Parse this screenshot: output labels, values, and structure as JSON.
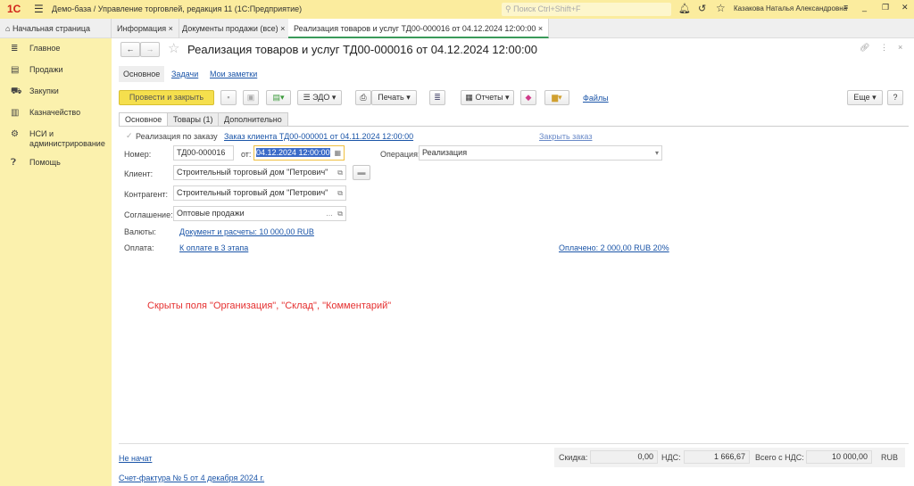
{
  "app": {
    "title": "Демо-база / Управление торговлей, редакция 11  (1С:Предприятие)",
    "search_placeholder": "Поиск Ctrl+Shift+F",
    "user": "Казакова Наталья Александровна"
  },
  "tabs": [
    {
      "label": "Начальная страница"
    },
    {
      "label": "Информация"
    },
    {
      "label": "Документы продажи (все)"
    },
    {
      "label": "Реализация товаров и услуг ТД00-000016 от 04.12.2024 12:00:00"
    }
  ],
  "sidebar": {
    "items": [
      {
        "label": "Главное",
        "icon": "menu-icon"
      },
      {
        "label": "Продажи",
        "icon": "sales-icon"
      },
      {
        "label": "Закупки",
        "icon": "cart-icon"
      },
      {
        "label": "Казначейство",
        "icon": "treasury-icon"
      },
      {
        "label": "НСИ и администрирование",
        "icon": "settings-icon"
      },
      {
        "label": "Помощь",
        "icon": "help-icon"
      }
    ]
  },
  "doc": {
    "title": "Реализация товаров и услуг ТД00-000016 от 04.12.2024 12:00:00",
    "subtabs": [
      "Основное",
      "Задачи",
      "Мои заметки"
    ],
    "toolbar": {
      "post_close": "Провести и закрыть",
      "edo": "ЭДО",
      "print": "Печать",
      "reports": "Отчеты",
      "files": "Файлы",
      "more": "Еще",
      "help": "?"
    },
    "form_tabs": [
      "Основное",
      "Товары (1)",
      "Дополнительно"
    ],
    "by_order_label": "Реализация по заказу",
    "order_link": "Заказ клиента ТД00-000001 от 04.11.2024 12:00:00",
    "close_order": "Закрыть заказ",
    "number_label": "Номер:",
    "number": "ТД00-000016",
    "date_label": "от:",
    "date": "04.12.2024 12:00:00",
    "operation_label": "Операция:",
    "operation": "Реализация",
    "client_label": "Клиент:",
    "client": "Строительный торговый дом \"Петрович\"",
    "contractor_label": "Контрагент:",
    "contractor": "Строительный торговый дом \"Петрович\"",
    "agreement_label": "Соглашение:",
    "agreement": "Оптовые продажи",
    "currency_label": "Валюты:",
    "currency_link": "Документ и расчеты: 10 000,00 RUB",
    "payment_label": "Оплата:",
    "payment_link": "К оплате в 3 этапа",
    "paid_link": "Оплачено: 2 000,00 RUB 20%",
    "note": "Скрыты поля \"Организация\", \"Склад\", \"Комментарий\"",
    "status_link": "Не начат",
    "invoice_link": "Счет-фактура № 5 от 4 декабря 2024 г.",
    "totals": {
      "discount_label": "Скидка:",
      "discount": "0,00",
      "vat_label": "НДС:",
      "vat": "1 666,67",
      "total_label": "Всего с НДС:",
      "total": "10 000,00",
      "currency": "RUB"
    }
  },
  "colors": {
    "topbar": "#fbec9e",
    "sidebar": "#fbf1ad",
    "accent_button": "#f5df4d",
    "link": "#1b55a8",
    "note": "#e53030"
  }
}
